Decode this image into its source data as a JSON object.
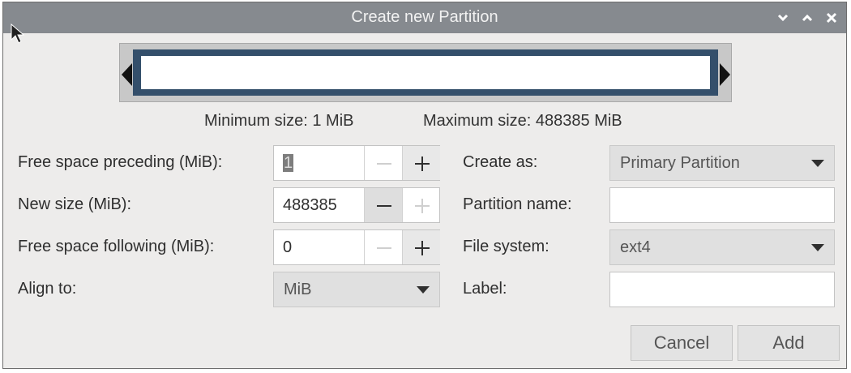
{
  "window": {
    "title": "Create new Partition"
  },
  "partition_bar": {
    "min_label": "Minimum size: 1 MiB",
    "max_label": "Maximum size: 488385 MiB"
  },
  "form": {
    "free_preceding": {
      "label": "Free space preceding (MiB):",
      "value": "1"
    },
    "new_size": {
      "label": "New size (MiB):",
      "value": "488385"
    },
    "free_following": {
      "label": "Free space following (MiB):",
      "value": "0"
    },
    "align_to": {
      "label": "Align to:",
      "value": "MiB"
    },
    "create_as": {
      "label": "Create as:",
      "value": "Primary Partition"
    },
    "partition_name": {
      "label": "Partition name:",
      "value": ""
    },
    "file_system": {
      "label": "File system:",
      "value": "ext4"
    },
    "fs_label": {
      "label": "Label:",
      "value": ""
    }
  },
  "buttons": {
    "cancel": "Cancel",
    "add": "Add"
  },
  "icons": [
    "minimize-icon",
    "maximize-icon",
    "close-icon",
    "minus-icon",
    "plus-icon",
    "chevron-down-icon",
    "mouse-cursor"
  ]
}
